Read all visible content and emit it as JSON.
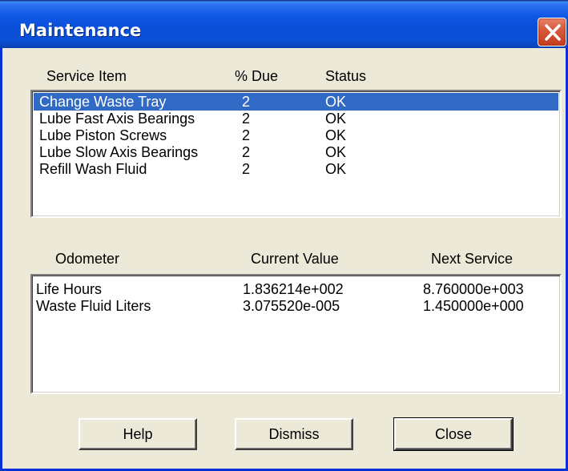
{
  "window": {
    "title": "Maintenance"
  },
  "service_list": {
    "headers": {
      "item": "Service Item",
      "due": "% Due",
      "status": "Status"
    },
    "rows": [
      {
        "item": "Change Waste Tray",
        "due": "2",
        "status": "OK",
        "selected": true
      },
      {
        "item": "Lube Fast Axis Bearings",
        "due": "2",
        "status": "OK",
        "selected": false
      },
      {
        "item": "Lube Piston Screws",
        "due": "2",
        "status": "OK",
        "selected": false
      },
      {
        "item": "Lube Slow Axis Bearings",
        "due": "2",
        "status": "OK",
        "selected": false
      },
      {
        "item": "Refill Wash Fluid",
        "due": "2",
        "status": "OK",
        "selected": false
      }
    ]
  },
  "odometer_list": {
    "headers": {
      "odometer": "Odometer",
      "current": "Current Value",
      "next": "Next Service"
    },
    "rows": [
      {
        "odometer": "Life Hours",
        "current": "1.836214e+002",
        "next": "8.760000e+003"
      },
      {
        "odometer": "Waste Fluid Liters",
        "current": "3.075520e-005",
        "next": "1.450000e+000"
      }
    ]
  },
  "buttons": {
    "help": "Help",
    "dismiss": "Dismiss",
    "close": "Close"
  },
  "colors": {
    "title_bar": "#0a4fd8",
    "selection": "#316ac5",
    "dialog_face": "#ece9d8",
    "close_button": "#d75a3c"
  },
  "icons": {
    "close": "close-icon"
  }
}
